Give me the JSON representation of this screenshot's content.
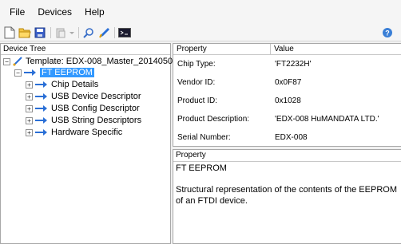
{
  "menu": {
    "file": "File",
    "devices": "Devices",
    "help": "Help"
  },
  "toolbar": {
    "icons": [
      "new-document-icon",
      "open-folder-icon",
      "save-icon",
      "paste-icon",
      "search-icon",
      "program-icon",
      "console-icon",
      "help-icon"
    ]
  },
  "tree": {
    "header": "Device Tree",
    "template": "Template: EDX-008_Master_2014050",
    "root": "FT EEPROM",
    "children": [
      "Chip Details",
      "USB Device Descriptor",
      "USB Config Descriptor",
      "USB String Descriptors",
      "Hardware Specific"
    ]
  },
  "properties": {
    "header_property": "Property",
    "header_value": "Value",
    "rows": [
      {
        "property": "Chip Type:",
        "value": "'FT2232H'"
      },
      {
        "property": "Vendor ID:",
        "value": "0x0F87"
      },
      {
        "property": "Product ID:",
        "value": "0x1028"
      },
      {
        "property": "Product Description:",
        "value": "'EDX-008 HuMANDATA LTD.'"
      },
      {
        "property": "Serial Number:",
        "value": "EDX-008"
      }
    ]
  },
  "description": {
    "header": "Property",
    "title": "FT EEPROM",
    "body": "Structural representation of the contents of the EEPROM of an FTDI device."
  },
  "colors": {
    "selection": "#3399ff",
    "arrow": "#2a6fd6"
  }
}
